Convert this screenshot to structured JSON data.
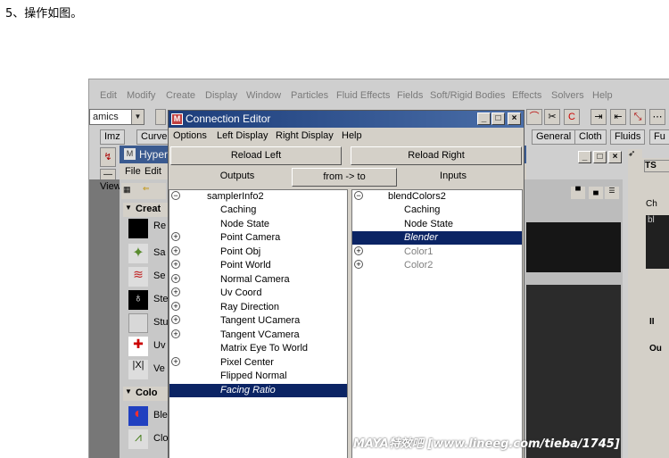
{
  "caption": "5、操作如图。",
  "maya_menu": [
    "Edit",
    "Modify",
    "Create",
    "Display",
    "Window",
    "Particles",
    "Fluid Effects",
    "Fields",
    "Soft/Rigid Bodies",
    "Effects",
    "Solvers",
    "Help"
  ],
  "maya_toolbar": {
    "mode_combo": "amics"
  },
  "shelf_tabs": [
    "Imz",
    "Curve",
    "General",
    "Cloth",
    "Fluids",
    "Fu"
  ],
  "hypershade": {
    "title": "Hyper",
    "menu": [
      "File",
      "Edit"
    ],
    "view_label": "View",
    "create_section": "Creat",
    "color_section": "Colo",
    "items": [
      "Re",
      "Sa",
      "Se",
      "Ste",
      "Stu",
      "Uv",
      "Ve",
      "Ble",
      "Clo"
    ]
  },
  "right_panel": {
    "tab": "TS",
    "labels": [
      "Ch",
      "bl",
      "II",
      "Ou"
    ]
  },
  "connection_editor": {
    "title": "Connection Editor",
    "menu": [
      "Options",
      "Left Display",
      "Right Display",
      "Help"
    ],
    "reload_left": "Reload Left",
    "reload_right": "Reload Right",
    "outputs_label": "Outputs",
    "direction_button": "from -> to",
    "inputs_label": "Inputs",
    "left_node": "samplerInfo2",
    "left_attrs": [
      {
        "label": "Caching",
        "expand": false
      },
      {
        "label": "Node State",
        "expand": false
      },
      {
        "label": "Point Camera",
        "expand": true
      },
      {
        "label": "Point Obj",
        "expand": true
      },
      {
        "label": "Point World",
        "expand": true
      },
      {
        "label": "Normal Camera",
        "expand": true
      },
      {
        "label": "Uv Coord",
        "expand": true
      },
      {
        "label": "Ray Direction",
        "expand": true
      },
      {
        "label": "Tangent UCamera",
        "expand": true
      },
      {
        "label": "Tangent VCamera",
        "expand": true
      },
      {
        "label": "Matrix Eye To World",
        "expand": false
      },
      {
        "label": "Pixel Center",
        "expand": true
      },
      {
        "label": "Flipped Normal",
        "expand": false
      },
      {
        "label": "Facing Ratio",
        "expand": false,
        "selected": true
      }
    ],
    "right_node": "blendColors2",
    "right_attrs": [
      {
        "label": "Caching",
        "expand": false
      },
      {
        "label": "Node State",
        "expand": false
      },
      {
        "label": "Blender",
        "expand": false,
        "selected": true
      },
      {
        "label": "Color1",
        "expand": true,
        "grey": true
      },
      {
        "label": "Color2",
        "expand": true,
        "grey": true
      }
    ]
  },
  "watermark": "MAYA特效吧  [www.lineeg.com/tieba/1745]",
  "colors": {
    "selection": "#0b2464",
    "title_bar": "#1c3d7a",
    "window_bg": "#d4d0c8"
  }
}
